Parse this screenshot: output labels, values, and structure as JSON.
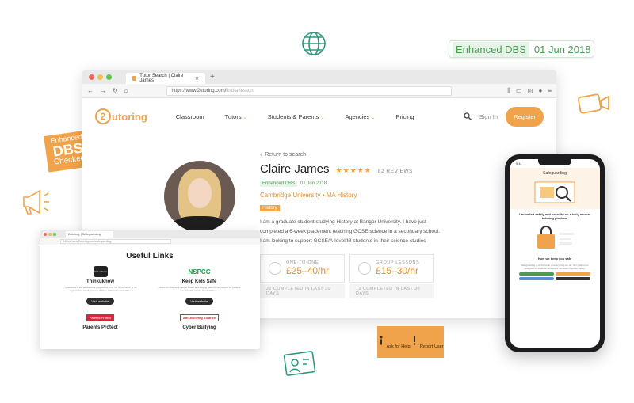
{
  "floating_badge": {
    "tag": "Enhanced DBS",
    "date": "01 Jun 2018"
  },
  "sticker": {
    "line1": "Enhanced",
    "line2": "DBS",
    "line3": "Checked"
  },
  "browser": {
    "tab_title": "Tutor Search | Claire James",
    "url_domain": "https://www.2utoring.com/",
    "url_path": "find-a-lesson"
  },
  "site": {
    "logo_text": "utoring",
    "logo_digit": "2",
    "nav": [
      "Classroom",
      "Tutors",
      "Students & Parents",
      "Agencies",
      "Pricing"
    ],
    "signin": "Sign In",
    "register": "Register"
  },
  "profile": {
    "back": "Return to search",
    "name": "Claire James",
    "stars": "★★★★★",
    "reviews": "82 REVIEWS",
    "dbs_tag": "Enhanced DBS",
    "dbs_date": "01 Jun 2018",
    "university": "Cambridge University • MA History",
    "subject": "History",
    "bio": "I am a graduate student studying History at Bangor University. I have just completed a 6-week placement teaching GCSE science in a secondary school. I am looking to support GCSE/A-level/IB students in their science studies (Physics up to GCSE only) by supporting their",
    "one_label": "ONE-TO-ONE",
    "one_price": "£25–40/hr",
    "group_label": "GROUP LESSONS",
    "group_price": "£15–30/hr",
    "one_done": "22 COMPLETED IN LAST 30 DAYS",
    "group_done": "12 COMPLETED IN LAST 30 DAYS"
  },
  "browser2": {
    "tab_title": "2utoring | Safeguarding",
    "url": "https://www.2utoring.com/safeguarding",
    "heading": "Useful Links",
    "links": [
      {
        "logo": "think u know",
        "title": "Thinkuknow",
        "desc": "Thinkuknow is the educational programme from the NCA-CEOP, a UK organisation which protects children both online and offline",
        "button": "Visit website"
      },
      {
        "logo": "NSPCC",
        "title": "Keep Kids Safe",
        "desc": "Advice on children's mental health and staying safe online; support for parents and adults worried about children",
        "button": "Visit website"
      },
      {
        "logo": "Parents Protect",
        "title": "Parents Protect",
        "desc": "",
        "button": ""
      },
      {
        "logo": "Anti-Bullying Alliance",
        "title": "Cyber Bullying",
        "desc": "",
        "button": ""
      }
    ]
  },
  "help": {
    "ask": "Ask for Help",
    "report": "Report User"
  },
  "phone": {
    "time": "9:41",
    "section": "Safeguarding",
    "headline": "Unrivalled safety and security on a truly neutral tutoring platform",
    "sub_headline": "How we keep you safe",
    "sub_text": "Safeguarding is at the heart of everything we do. Our platform is designed so students and tutors can learn together safely."
  },
  "colors": {
    "brand_orange": "#f0a34a",
    "dbs_green": "#4d9a55",
    "nspcc_green": "#1f9b47",
    "alert_red": "#d7263d"
  }
}
